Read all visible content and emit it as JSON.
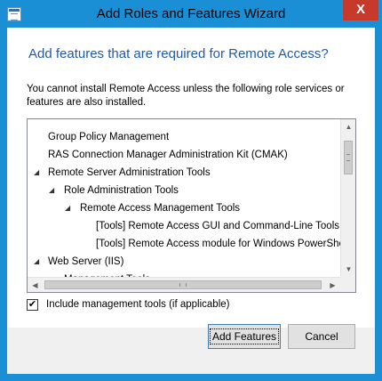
{
  "window": {
    "title": "Add Roles and Features Wizard",
    "close_glyph": "X"
  },
  "heading": "Add features that are required for Remote Access?",
  "description": "You cannot install Remote Access unless the following role services or features are also installed.",
  "tree": {
    "items": [
      {
        "label": "Group Policy Management",
        "expander": ""
      },
      {
        "label": "RAS Connection Manager Administration Kit (CMAK)",
        "expander": ""
      },
      {
        "label": "Remote Server Administration Tools",
        "expander": "◢"
      },
      {
        "label": "Role Administration Tools",
        "expander": "◢"
      },
      {
        "label": "Remote Access Management Tools",
        "expander": "◢"
      },
      {
        "label": "[Tools] Remote Access GUI and Command-Line Tools",
        "expander": ""
      },
      {
        "label": "[Tools] Remote Access module for Windows PowerShell",
        "expander": ""
      },
      {
        "label": "Web Server (IIS)",
        "expander": "◢"
      },
      {
        "label": "Management Tools",
        "expander": "◢"
      }
    ]
  },
  "include_tools": {
    "checked": true,
    "check_glyph": "✔",
    "label": "Include management tools (if applicable)"
  },
  "buttons": {
    "add_features": "Add Features",
    "cancel": "Cancel"
  },
  "colors": {
    "titlebar": "#1b8fd6",
    "close": "#c7392a",
    "heading": "#1e5aa8"
  },
  "scroll_glyphs": {
    "up": "▲",
    "down": "▼",
    "left": "◀",
    "right": "▶"
  }
}
